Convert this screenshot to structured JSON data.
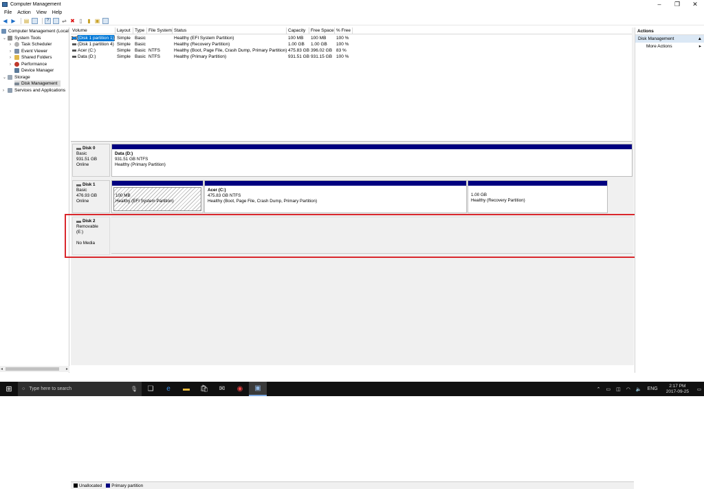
{
  "window": {
    "title": "Computer Management",
    "minimize": "–",
    "maximize": "❐",
    "close": "✕"
  },
  "menu": [
    "File",
    "Action",
    "View",
    "Help"
  ],
  "tree": {
    "root": "Computer Management (Local",
    "system_tools": "System Tools",
    "task_scheduler": "Task Scheduler",
    "event_viewer": "Event Viewer",
    "shared_folders": "Shared Folders",
    "performance": "Performance",
    "device_manager": "Device Manager",
    "storage": "Storage",
    "disk_management": "Disk Management",
    "services": "Services and Applications"
  },
  "volumes": {
    "headers": [
      "Volume",
      "Layout",
      "Type",
      "File System",
      "Status",
      "Capacity",
      "Free Space",
      "% Free"
    ],
    "rows": [
      [
        "(Disk 1 partition 1)",
        "Simple",
        "Basic",
        "",
        "Healthy (EFI System Partition)",
        "100 MB",
        "100 MB",
        "100 %"
      ],
      [
        "(Disk 1 partition 4)",
        "Simple",
        "Basic",
        "",
        "Healthy (Recovery Partition)",
        "1.00 GB",
        "1.00 GB",
        "100 %"
      ],
      [
        "Acer (C:)",
        "Simple",
        "Basic",
        "NTFS",
        "Healthy (Boot, Page File, Crash Dump, Primary Partition)",
        "475.83 GB",
        "396.02 GB",
        "83 %"
      ],
      [
        "Data (D:)",
        "Simple",
        "Basic",
        "NTFS",
        "Healthy (Primary Partition)",
        "931.51 GB",
        "931.15 GB",
        "100 %"
      ]
    ]
  },
  "disks": {
    "disk0": {
      "name": "Disk 0",
      "type": "Basic",
      "size": "931.51 GB",
      "state": "Online",
      "part": {
        "name": "Data (D:)",
        "size": "931.51 GB NTFS",
        "status": "Healthy (Primary Partition)"
      }
    },
    "disk1": {
      "name": "Disk 1",
      "type": "Basic",
      "size": "476.93 GB",
      "state": "Online",
      "p1": {
        "size": "100 MB",
        "status": "Healthy (EFI System Partition)"
      },
      "p2": {
        "name": "Acer (C:)",
        "size": "475.83 GB NTFS",
        "status": "Healthy (Boot, Page File, Crash Dump, Primary Partition)"
      },
      "p3": {
        "size": "1.00 GB",
        "status": "Healthy (Recovery Partition)"
      }
    },
    "disk2": {
      "name": "Disk 2",
      "type": "Removable (E:)",
      "state": "No Media"
    }
  },
  "legend": {
    "unallocated": "Unallocated",
    "primary": "Primary partition",
    "unallocated_color": "#000000",
    "primary_color": "#000080"
  },
  "actions": {
    "header": "Actions",
    "section": "Disk Management",
    "more": "More Actions"
  },
  "taskbar": {
    "search_placeholder": "Type here to search",
    "lang": "ENG",
    "time": "2:17 PM",
    "date": "2017-09-25"
  },
  "colors": {
    "accent": "#0078d7",
    "highlight_box": "#d9262b",
    "partition_band": "#000080"
  }
}
